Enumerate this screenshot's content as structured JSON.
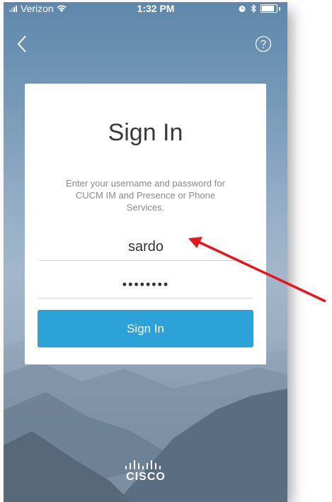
{
  "status_bar": {
    "carrier": "Verizon",
    "time": "1:32 PM"
  },
  "nav": {
    "back_icon": "chevron-left-icon",
    "help_icon": "question-circle-icon"
  },
  "signin": {
    "title": "Sign In",
    "description": "Enter your username and password for CUCM IM and Presence or Phone Services.",
    "username_value": "sardo",
    "password_value": "••••••••",
    "button_label": "Sign In"
  },
  "branding": {
    "logo_text": "CISCO"
  },
  "colors": {
    "accent": "#2ca2d8",
    "annotation_arrow": "#e8161b"
  }
}
